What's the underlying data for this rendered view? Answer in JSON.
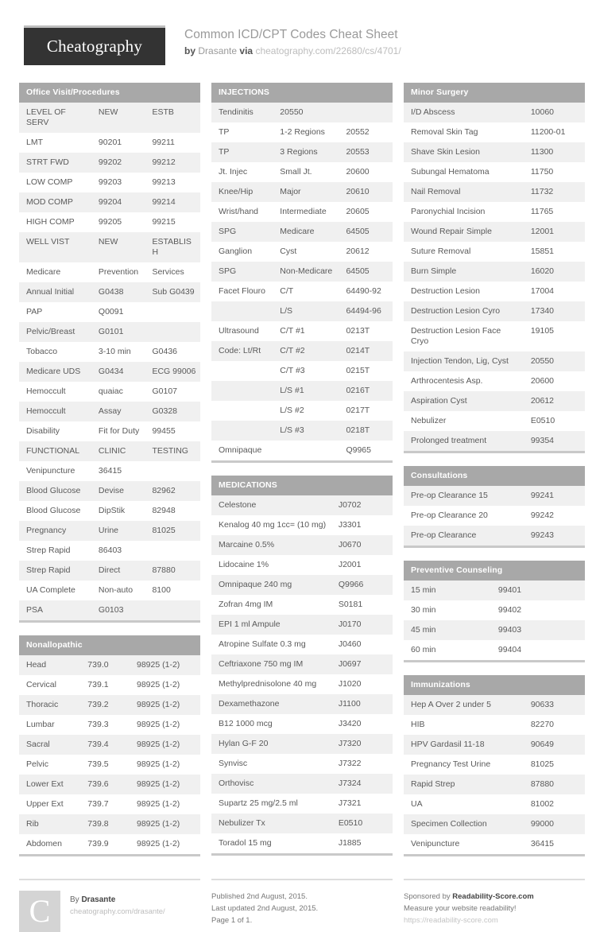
{
  "header": {
    "logo": "Cheatography",
    "title": "Common ICD/CPT Codes Cheat Sheet",
    "by_label": "by",
    "author": "Drasante",
    "via_label": "via",
    "source_url": "cheatography.com/22680/cs/4701/"
  },
  "columns": [
    {
      "sections": [
        {
          "title": "Office Visit/Procedures",
          "layout": "w3",
          "rows": [
            [
              "LEVEL OF SERV",
              "NEW",
              "ESTB"
            ],
            [
              "LMT",
              "90201",
              "99211"
            ],
            [
              "STRT FWD",
              "99202",
              "99212"
            ],
            [
              "LOW COMP",
              "99203",
              "99213"
            ],
            [
              "MOD COMP",
              "99204",
              "99214"
            ],
            [
              "HIGH COMP",
              "99205",
              "99215"
            ],
            [
              "WELL VIST",
              "NEW",
              "ESTABLISH"
            ],
            [
              "Medicare",
              "Prevention",
              "Services"
            ],
            [
              "Annual Initial",
              "G0438",
              "Sub G0439"
            ],
            [
              "PAP",
              "Q0091",
              ""
            ],
            [
              "Pelvic/Breast",
              "G0101",
              ""
            ],
            [
              "Tobacco",
              "3-10 min",
              "G0436"
            ],
            [
              "Medicare UDS",
              "G0434",
              "ECG 99006"
            ],
            [
              "Hemoccult",
              "quaiac",
              "G0107"
            ],
            [
              "Hemoccult",
              "Assay",
              "G0328"
            ],
            [
              "Disability",
              "Fit for Duty",
              "99455"
            ],
            [
              "FUNCTIONAL",
              "CLINIC",
              "TESTING"
            ],
            [
              "Venipuncture",
              "36415",
              ""
            ],
            [
              "Blood Glucose",
              "Devise",
              "82962"
            ],
            [
              "Blood Glucose",
              "DipStik",
              "82948"
            ],
            [
              "Pregnancy",
              "Urine",
              "81025"
            ],
            [
              "Strep Rapid",
              "86403",
              ""
            ],
            [
              "Strep Rapid",
              "Direct",
              "87880"
            ],
            [
              "UA Complete",
              "Non-auto",
              "8100"
            ],
            [
              "PSA",
              "G0103",
              ""
            ]
          ]
        },
        {
          "title": "Nonallopathic",
          "layout": "w3n",
          "rows": [
            [
              "Head",
              "739.0",
              "98925 (1-2)"
            ],
            [
              "Cervical",
              "739.1",
              "98925 (1-2)"
            ],
            [
              "Thoracic",
              "739.2",
              "98925 (1-2)"
            ],
            [
              "Lumbar",
              "739.3",
              "98925 (1-2)"
            ],
            [
              "Sacral",
              "739.4",
              "98925 (1-2)"
            ],
            [
              "Pelvic",
              "739.5",
              "98925 (1-2)"
            ],
            [
              "Lower Ext",
              "739.6",
              "98925 (1-2)"
            ],
            [
              "Upper Ext",
              "739.7",
              "98925 (1-2)"
            ],
            [
              "Rib",
              "739.8",
              "98925 (1-2)"
            ],
            [
              "Abdomen",
              "739.9",
              "98925 (1-2)"
            ]
          ]
        }
      ]
    },
    {
      "sections": [
        {
          "title": "INJECTIONS",
          "layout": "w3b",
          "rows": [
            [
              "Tendinitis",
              "20550",
              ""
            ],
            [
              "TP",
              "1-2 Regions",
              "20552"
            ],
            [
              "TP",
              "3 Regions",
              "20553"
            ],
            [
              "Jt. Injec",
              "Small Jt.",
              "20600"
            ],
            [
              "Knee/Hip",
              "Major",
              "20610"
            ],
            [
              "Wrist/hand",
              "Intermediate",
              "20605"
            ],
            [
              "SPG",
              "Medicare",
              "64505"
            ],
            [
              "Ganglion",
              "Cyst",
              "20612"
            ],
            [
              "SPG",
              "Non-Medicare",
              "64505"
            ],
            [
              "Facet Flouro",
              "C/T",
              "64490-92"
            ],
            [
              "",
              "L/S",
              "64494-96"
            ],
            [
              "Ultrasound",
              "C/T #1",
              "0213T"
            ],
            [
              "Code: Lt/Rt",
              "C/T #2",
              "0214T"
            ],
            [
              "",
              "C/T #3",
              "0215T"
            ],
            [
              "",
              "L/S #1",
              "0216T"
            ],
            [
              "",
              "L/S #2",
              "0217T"
            ],
            [
              "",
              "L/S #3",
              "0218T"
            ],
            [
              "Omnipaque",
              "",
              "Q9965"
            ]
          ]
        },
        {
          "title": "MEDICATIONS",
          "layout": "w2",
          "rows": [
            [
              "Celestone",
              "J0702"
            ],
            [
              "Kenalog 40 mg 1cc= (10 mg)",
              "J3301"
            ],
            [
              "Marcaine 0.5%",
              "J0670"
            ],
            [
              "Lidocaine 1%",
              "J2001"
            ],
            [
              "Omnipaque 240 mg",
              "Q9966"
            ],
            [
              "Zofran 4mg IM",
              "S0181"
            ],
            [
              "EPI 1 ml Ampule",
              "J0170"
            ],
            [
              "Atropine Sulfate 0.3 mg",
              "J0460"
            ],
            [
              "Ceftriaxone 750 mg IM",
              "J0697"
            ],
            [
              "Methylprednisolone 40 mg",
              "J1020"
            ],
            [
              "Dexamethazone",
              "J1100"
            ],
            [
              "B12 1000 mcg",
              "J3420"
            ],
            [
              "Hylan G-F 20",
              "J7320"
            ],
            [
              "Synvisc",
              "J7322"
            ],
            [
              "Orthovisc",
              "J7324"
            ],
            [
              "Supartz 25 mg/2.5 ml",
              "J7321"
            ],
            [
              "Nebulizer Tx",
              "E0510"
            ],
            [
              "Toradol 15 mg",
              "J1885"
            ]
          ]
        }
      ]
    },
    {
      "sections": [
        {
          "title": "Minor Surgery",
          "layout": "w2",
          "rows": [
            [
              "I/D Abscess",
              "10060"
            ],
            [
              "Removal Skin Tag",
              "11200-01"
            ],
            [
              "Shave Skin Lesion",
              "11300"
            ],
            [
              "Subungal Hematoma",
              "11750"
            ],
            [
              "Nail Removal",
              "11732"
            ],
            [
              "Paronychial Incision",
              "11765"
            ],
            [
              "Wound Repair Simple",
              "12001"
            ],
            [
              "Suture Removal",
              "15851"
            ],
            [
              "Burn Simple",
              "16020"
            ],
            [
              "Destruction Lesion",
              "17004"
            ],
            [
              "Destruction Lesion Cyro",
              "17340"
            ],
            [
              "Destruction Lesion Face Cryo",
              "19105"
            ],
            [
              "Injection Tendon, Lig, Cyst",
              "20550"
            ],
            [
              "Arthrocentesis Asp.",
              "20600"
            ],
            [
              "Aspiration Cyst",
              "20612"
            ],
            [
              "Nebulizer",
              "E0510"
            ],
            [
              "Prolonged treatment",
              "99354"
            ]
          ]
        },
        {
          "title": "Consultations",
          "layout": "w2",
          "rows": [
            [
              "Pre-op Clearance 15",
              "99241"
            ],
            [
              "Pre-op Clearance 20",
              "99242"
            ],
            [
              "Pre-op Clearance",
              "99243"
            ]
          ]
        },
        {
          "title": "Preventive Counseling",
          "layout": "w2c",
          "rows": [
            [
              "15 min",
              "99401"
            ],
            [
              "30 min",
              "99402"
            ],
            [
              "45 min",
              "99403"
            ],
            [
              "60 min",
              "99404"
            ]
          ]
        },
        {
          "title": "Immunizations",
          "layout": "w2",
          "rows": [
            [
              "Hep A Over 2 under 5",
              "90633"
            ],
            [
              "HIB",
              "82270"
            ],
            [
              "HPV Gardasil 11-18",
              "90649"
            ],
            [
              "Pregnancy Test Urine",
              "81025"
            ],
            [
              "Rapid Strep",
              "87880"
            ],
            [
              "UA",
              "81002"
            ],
            [
              "Specimen Collection",
              "99000"
            ],
            [
              "Venipuncture",
              "36415"
            ]
          ]
        }
      ]
    }
  ],
  "footer": {
    "avatar_initial": "C",
    "by_label": "By",
    "author": "Drasante",
    "author_url": "cheatography.com/drasante/",
    "published": "Published 2nd August, 2015.",
    "last_updated": "Last updated 2nd August, 2015.",
    "page": "Page 1 of 1.",
    "sponsor_label": "Sponsored by",
    "sponsor_name": "Readability-Score.com",
    "sponsor_tagline": "Measure your website readability!",
    "sponsor_url": "https://readability-score.com"
  },
  "colors": {
    "section_header_bg": "#a8a8a8",
    "row_alt_bg": "#f0f0f0",
    "logo_bg": "#333333",
    "text": "#5a5a5a"
  }
}
